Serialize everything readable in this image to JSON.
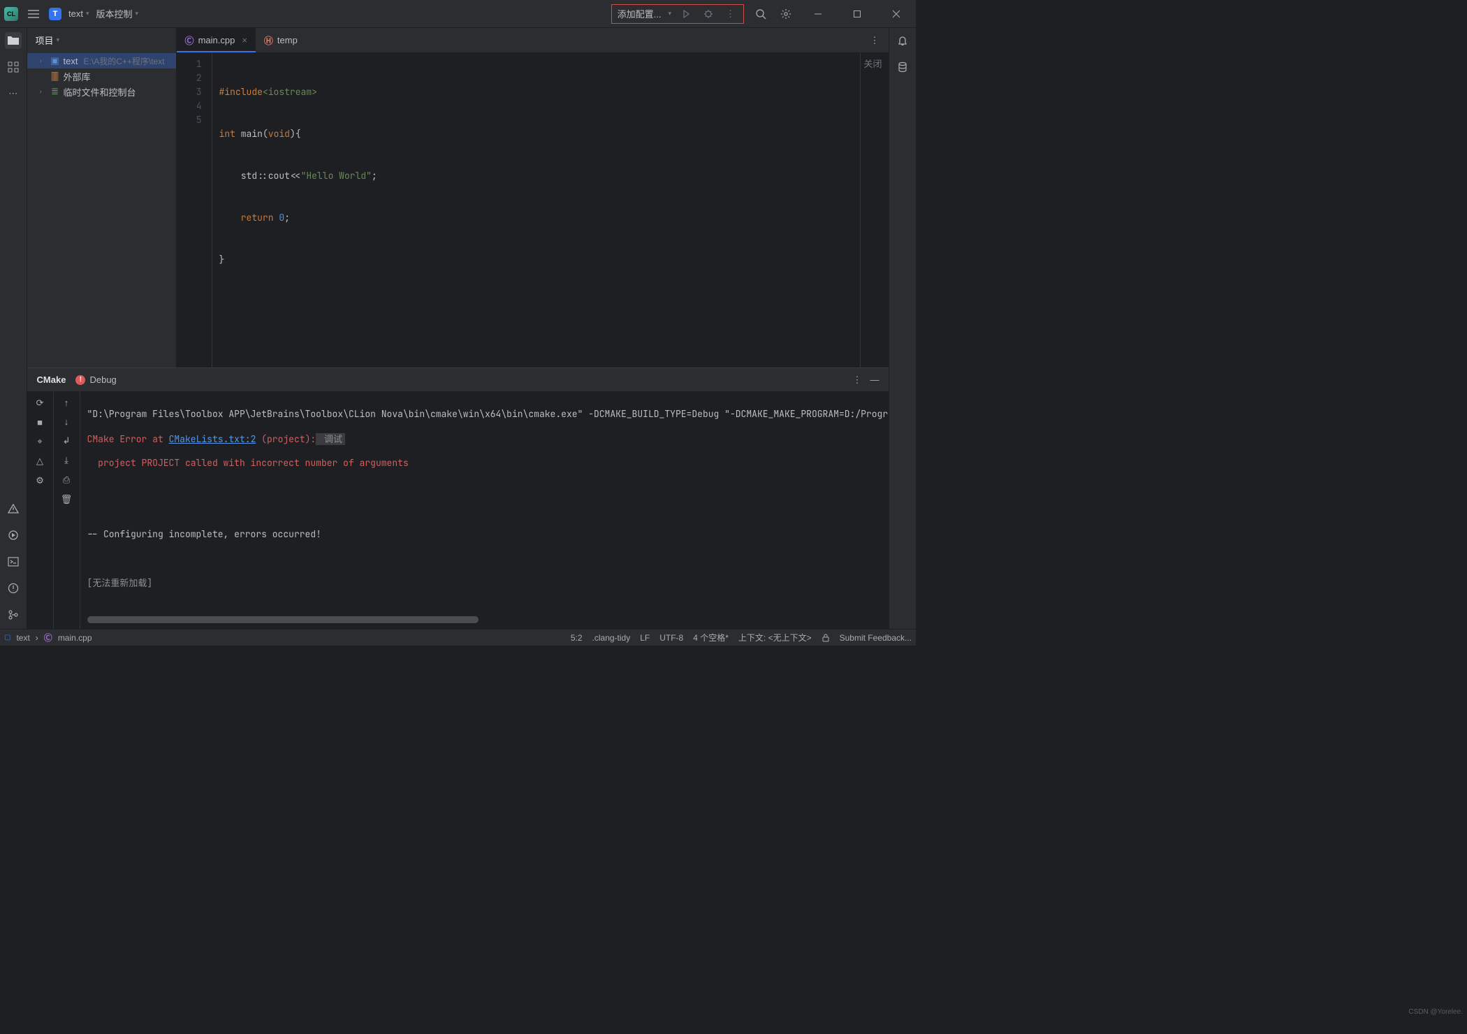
{
  "titlebar": {
    "proj_letter": "T",
    "proj_name": "text",
    "vcs": "版本控制",
    "run_config_label": "添加配置..."
  },
  "project": {
    "head": "项目",
    "root_name": "text",
    "root_path": "E:\\A我的C++程序\\text",
    "lib": "外部库",
    "scratch": "临时文件和控制台"
  },
  "tabs": {
    "main": "main.cpp",
    "temp": "temp",
    "close_lbl": "关闭"
  },
  "code": {
    "l1a": "#include",
    "l1b": "<iostream>",
    "l2a": "int",
    "l2b": " main(",
    "l2c": "void",
    "l2d": "){",
    "l3a": "    std::cout<<",
    "l3b": "\"Hello World\"",
    "l3c": ";",
    "l4a": "    ",
    "l4b": "return",
    "l4c": " ",
    "l4d": "0",
    "l4e": ";",
    "l5": "}"
  },
  "gutter": [
    "1",
    "2",
    "3",
    "4",
    "5"
  ],
  "bottom": {
    "tab_cmake": "CMake",
    "tab_debug": "Debug",
    "out1": "\"D:\\Program Files\\Toolbox APP\\JetBrains\\Toolbox\\CLion Nova\\bin\\cmake\\win\\x64\\bin\\cmake.exe\" -DCMAKE_BUILD_TYPE=Debug \"-DCMAKE_MAKE_PROGRAM=D:/Program Fi",
    "out2a": "CMake Error at ",
    "out2b": "CMakeLists.txt:2",
    "out2c": " (project):",
    "out2d": " 调试",
    "out3": "  project PROJECT called with incorrect number of arguments",
    "out4": "-- Configuring incomplete, errors occurred!",
    "out5": "[无法重新加载]"
  },
  "status": {
    "root": "text",
    "file": "main.cpp",
    "pos": "5:2",
    "tidy": ".clang-tidy",
    "eol": "LF",
    "enc": "UTF-8",
    "indent": "4 个空格*",
    "ctx": "上下文: <无上下文>",
    "feedback": "Submit Feedback...",
    "watermark": "CSDN @Yorelee."
  }
}
